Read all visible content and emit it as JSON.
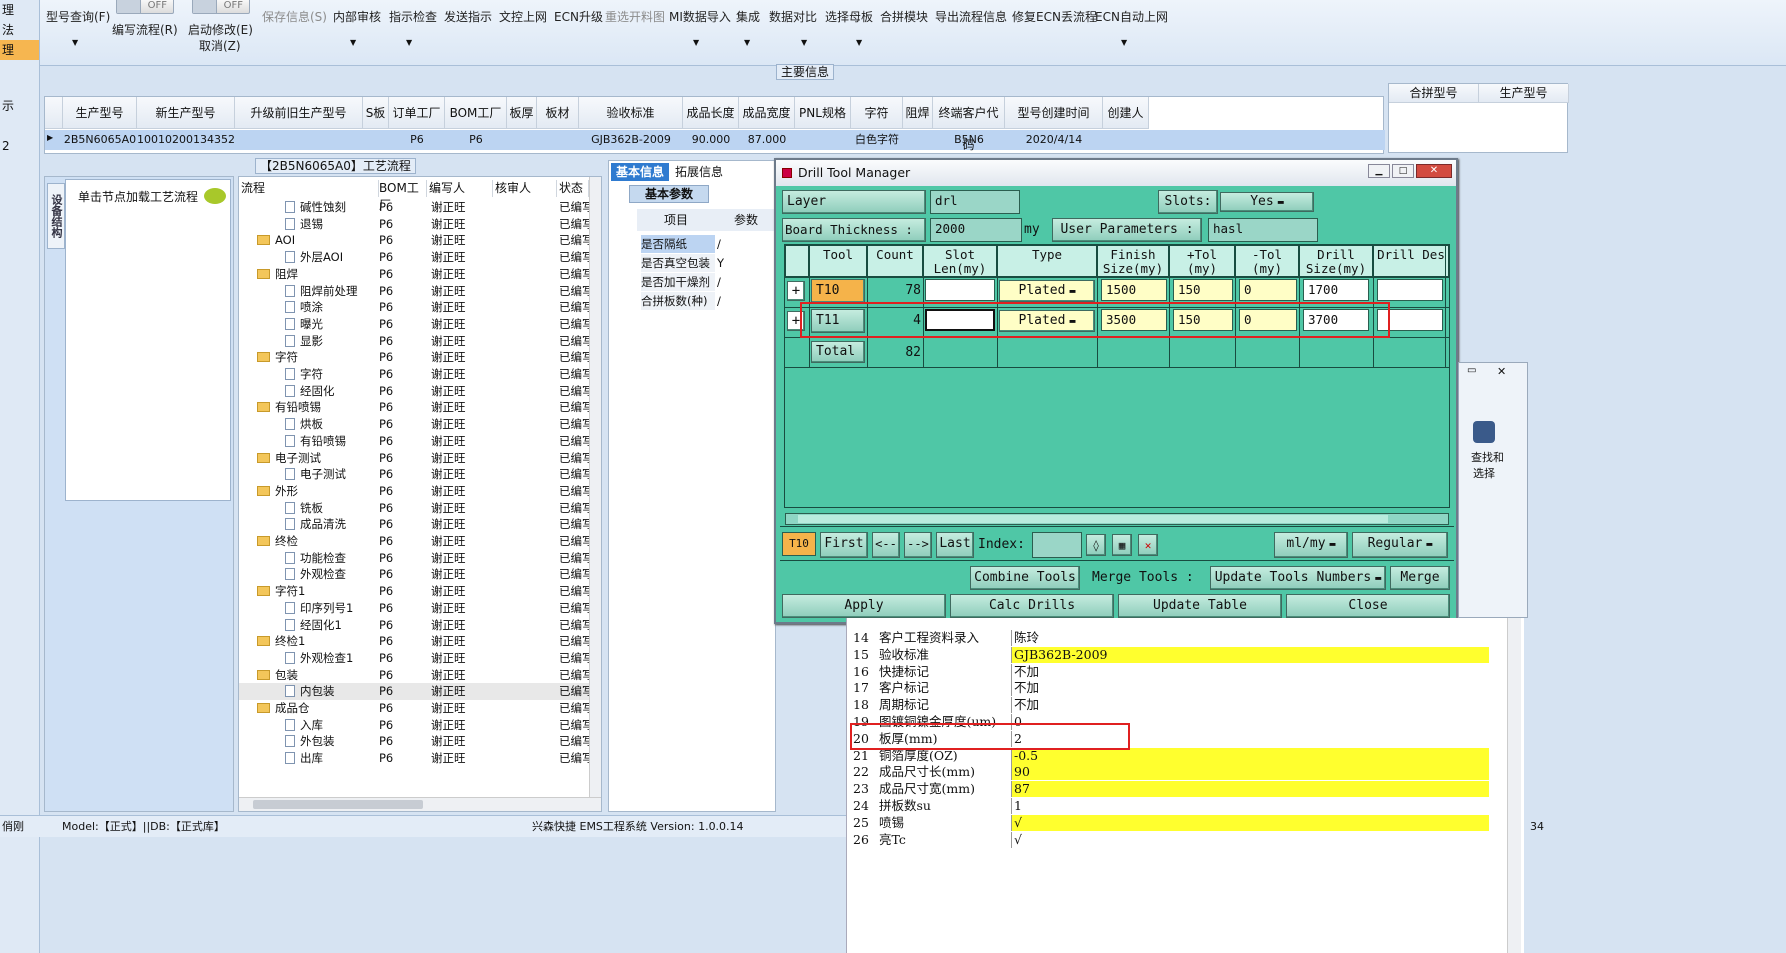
{
  "left_nav": [
    "理",
    "法",
    "理",
    "示",
    "2"
  ],
  "ribbon": {
    "buttons": [
      {
        "label": "型号查询(F)",
        "dis": false
      },
      {
        "label": "编写流程(R)",
        "dis": false
      },
      {
        "label": "启动修改(E)",
        "dis": false
      },
      {
        "label": "取消(Z)",
        "dis": false
      },
      {
        "label": "保存信息(S)",
        "dis": true
      },
      {
        "label": "内部审核",
        "dis": false
      },
      {
        "label": "指示检查",
        "dis": false
      },
      {
        "label": "发送指示",
        "dis": false
      },
      {
        "label": "文控上网",
        "dis": false
      },
      {
        "label": "ECN升级",
        "dis": false
      },
      {
        "label": "重选开料图",
        "dis": true
      },
      {
        "label": "MI数据导入",
        "dis": false
      },
      {
        "label": "集成",
        "dis": false
      },
      {
        "label": "数据对比",
        "dis": false
      },
      {
        "label": "选择母板",
        "dis": false
      },
      {
        "label": "合拼模块",
        "dis": false
      },
      {
        "label": "导出流程信息",
        "dis": false
      },
      {
        "label": "修复ECN丢流程",
        "dis": false
      },
      {
        "label": "ECN自动上网",
        "dis": false
      }
    ],
    "toggle_off": "OFF"
  },
  "main_info": {
    "title": "主要信息",
    "columns": [
      "生产型号",
      "新生产型号",
      "升级前旧生产型号",
      "S板",
      "订单工厂",
      "BOM工厂",
      "板厚",
      "板材",
      "验收标准",
      "成品长度",
      "成品宽度",
      "PNL规格",
      "字符",
      "阻焊",
      "终端客户代码",
      "型号创建时间",
      "创建人"
    ],
    "row": [
      "2B5N6065A0",
      "10010200134352",
      "",
      "",
      "P6",
      "P6",
      "",
      "",
      "GJB362B-2009",
      "90.000",
      "87.000",
      "",
      "白色字符",
      "",
      "B5N6",
      "2020/4/14",
      ""
    ],
    "right_columns": [
      "合拼型号",
      "生产型号"
    ]
  },
  "process_panel": {
    "title": "【2B5N6065A0】工艺流程",
    "vertical_tab": "设备结构",
    "hint": "单击节点加载工艺流程",
    "columns": [
      "流程",
      "BOM工厂",
      "编写人",
      "核审人",
      "状态"
    ],
    "rows": [
      {
        "name": "碱性蚀刻",
        "lvl": 2,
        "bom": "P6",
        "writer": "谢正旺",
        "status": "已编写"
      },
      {
        "name": "退锡",
        "lvl": 2,
        "bom": "P6",
        "writer": "谢正旺",
        "status": "已编写"
      },
      {
        "name": "AOI",
        "lvl": 1,
        "bom": "P6",
        "writer": "谢正旺",
        "status": "已编写"
      },
      {
        "name": "外层AOI",
        "lvl": 2,
        "bom": "P6",
        "writer": "谢正旺",
        "status": "已编写"
      },
      {
        "name": "阻焊",
        "lvl": 1,
        "bom": "P6",
        "writer": "谢正旺",
        "status": "已编写"
      },
      {
        "name": "阻焊前处理",
        "lvl": 2,
        "bom": "P6",
        "writer": "谢正旺",
        "status": "已编写"
      },
      {
        "name": "喷涂",
        "lvl": 2,
        "bom": "P6",
        "writer": "谢正旺",
        "status": "已编写"
      },
      {
        "name": "曝光",
        "lvl": 2,
        "bom": "P6",
        "writer": "谢正旺",
        "status": "已编写"
      },
      {
        "name": "显影",
        "lvl": 2,
        "bom": "P6",
        "writer": "谢正旺",
        "status": "已编写"
      },
      {
        "name": "字符",
        "lvl": 1,
        "bom": "P6",
        "writer": "谢正旺",
        "status": "已编写"
      },
      {
        "name": "字符",
        "lvl": 2,
        "bom": "P6",
        "writer": "谢正旺",
        "status": "已编写"
      },
      {
        "name": "经固化",
        "lvl": 2,
        "bom": "P6",
        "writer": "谢正旺",
        "status": "已编写"
      },
      {
        "name": "有铅喷锡",
        "lvl": 1,
        "bom": "P6",
        "writer": "谢正旺",
        "status": "已编写"
      },
      {
        "name": "烘板",
        "lvl": 2,
        "bom": "P6",
        "writer": "谢正旺",
        "status": "已编写"
      },
      {
        "name": "有铅喷锡",
        "lvl": 2,
        "bom": "P6",
        "writer": "谢正旺",
        "status": "已编写"
      },
      {
        "name": "电子测试",
        "lvl": 1,
        "bom": "P6",
        "writer": "谢正旺",
        "status": "已编写"
      },
      {
        "name": "电子测试",
        "lvl": 2,
        "bom": "P6",
        "writer": "谢正旺",
        "status": "已编写"
      },
      {
        "name": "外形",
        "lvl": 1,
        "bom": "P6",
        "writer": "谢正旺",
        "status": "已编写"
      },
      {
        "name": "铣板",
        "lvl": 2,
        "bom": "P6",
        "writer": "谢正旺",
        "status": "已编写"
      },
      {
        "name": "成品清洗",
        "lvl": 2,
        "bom": "P6",
        "writer": "谢正旺",
        "status": "已编写"
      },
      {
        "name": "终检",
        "lvl": 1,
        "bom": "P6",
        "writer": "谢正旺",
        "status": "已编写"
      },
      {
        "name": "功能检查",
        "lvl": 2,
        "bom": "P6",
        "writer": "谢正旺",
        "status": "已编写"
      },
      {
        "name": "外观检查",
        "lvl": 2,
        "bom": "P6",
        "writer": "谢正旺",
        "status": "已编写"
      },
      {
        "name": "字符1",
        "lvl": 1,
        "bom": "P6",
        "writer": "谢正旺",
        "status": "已编写"
      },
      {
        "name": "印序列号1",
        "lvl": 2,
        "bom": "P6",
        "writer": "谢正旺",
        "status": "已编写"
      },
      {
        "name": "经固化1",
        "lvl": 2,
        "bom": "P6",
        "writer": "谢正旺",
        "status": "已编写"
      },
      {
        "name": "终检1",
        "lvl": 1,
        "bom": "P6",
        "writer": "谢正旺",
        "status": "已编写"
      },
      {
        "name": "外观检查1",
        "lvl": 2,
        "bom": "P6",
        "writer": "谢正旺",
        "status": "已编写"
      },
      {
        "name": "包装",
        "lvl": 1,
        "bom": "P6",
        "writer": "谢正旺",
        "status": "已编写"
      },
      {
        "name": "内包装",
        "lvl": 2,
        "bom": "P6",
        "writer": "谢正旺",
        "status": "已编写"
      },
      {
        "name": "成品仓",
        "lvl": 1,
        "bom": "P6",
        "writer": "谢正旺",
        "status": "已编写"
      },
      {
        "name": "入库",
        "lvl": 2,
        "bom": "P6",
        "writer": "谢正旺",
        "status": "已编写"
      },
      {
        "name": "外包装",
        "lvl": 2,
        "bom": "P6",
        "writer": "谢正旺",
        "status": "已编写"
      },
      {
        "name": "出库",
        "lvl": 2,
        "bom": "P6",
        "writer": "谢正旺",
        "status": "已编写"
      }
    ]
  },
  "basic_info": {
    "tabs": [
      "基本信息",
      "拓展信息"
    ],
    "subtab": "基本参数",
    "columns": [
      "项目",
      "参数"
    ],
    "rows": [
      [
        "是否隔纸",
        "/"
      ],
      [
        "是否真空包装",
        "Y"
      ],
      [
        "是否加干燥剂",
        "/"
      ],
      [
        "合拼板数(种)",
        "/"
      ]
    ]
  },
  "dialog": {
    "title": "Drill Tool Manager",
    "layer_label": "Layer             :",
    "layer_value": "drl",
    "slots_label": "Slots:",
    "slots_value": "Yes",
    "thickness_label": "Board Thickness :",
    "thickness_value": "2000",
    "thickness_unit": "my",
    "user_params_label": "User Parameters :",
    "user_params_value": "hasl",
    "headers": [
      "Tool",
      "Count",
      "Slot Len(my)",
      "Type",
      "Finish Size(my)",
      "+Tol (my)",
      "-Tol (my)",
      "Drill Size(my)",
      "Drill Des"
    ],
    "tools": [
      {
        "tool": "T10",
        "count": "78",
        "slot": "",
        "type": "Plated",
        "finish": "1500",
        "ptol": "150",
        "mtol": "0",
        "drill": "1700",
        "des": ""
      },
      {
        "tool": "T11",
        "count": "4",
        "slot": "",
        "type": "Plated",
        "finish": "3500",
        "ptol": "150",
        "mtol": "0",
        "drill": "3700",
        "des": ""
      }
    ],
    "total_label": "Total",
    "total_count": "82",
    "current_tool": "T10",
    "nav": {
      "first": "First",
      "prev": "<--",
      "next": "-->",
      "last": "Last",
      "index": "Index:"
    },
    "units": "ml/my",
    "mode": "Regular",
    "combine": "Combine Tools",
    "merge_label": "Merge Tools :",
    "update_numbers": "Update Tools Numbers",
    "merge": "Merge",
    "apply": "Apply",
    "calc": "Calc Drills",
    "update_table": "Update Table",
    "close": "Close"
  },
  "right_sheet": {
    "rows": [
      {
        "n": "14",
        "k": "客户工程资料录入",
        "v": "陈玲",
        "y": false
      },
      {
        "n": "15",
        "k": "验收标准",
        "v": "GJB362B-2009",
        "y": true
      },
      {
        "n": "16",
        "k": "快捷标记",
        "v": "不加",
        "y": false
      },
      {
        "n": "17",
        "k": "客户标记",
        "v": "不加",
        "y": false
      },
      {
        "n": "18",
        "k": "周期标记",
        "v": "不加",
        "y": false
      },
      {
        "n": "19",
        "k": "图镀铜镍金厚度(um)",
        "v": "0",
        "y": false
      },
      {
        "n": "20",
        "k": "板厚(mm)",
        "v": "2",
        "y": false
      },
      {
        "n": "21",
        "k": "铜箔厚度(OZ)",
        "v": "-0.5",
        "y": true
      },
      {
        "n": "22",
        "k": "成品尺寸长(mm)",
        "v": "90",
        "y": true
      },
      {
        "n": "23",
        "k": "成品尺寸宽(mm)",
        "v": "87",
        "y": true
      },
      {
        "n": "24",
        "k": "拼板数su",
        "v": "1",
        "y": false
      },
      {
        "n": "25",
        "k": "喷锡",
        "v": "√",
        "y": true
      },
      {
        "n": "26",
        "k": "亮Tc",
        "v": "√",
        "y": false
      }
    ],
    "findbtn": "查找和",
    "select": "选择",
    "num": "34"
  },
  "status": {
    "left": "俏刚",
    "model": "Model:【正式】||DB:【正式库】",
    "app": "兴森快捷 EMS工程系统 Version: 1.0.0.14"
  }
}
